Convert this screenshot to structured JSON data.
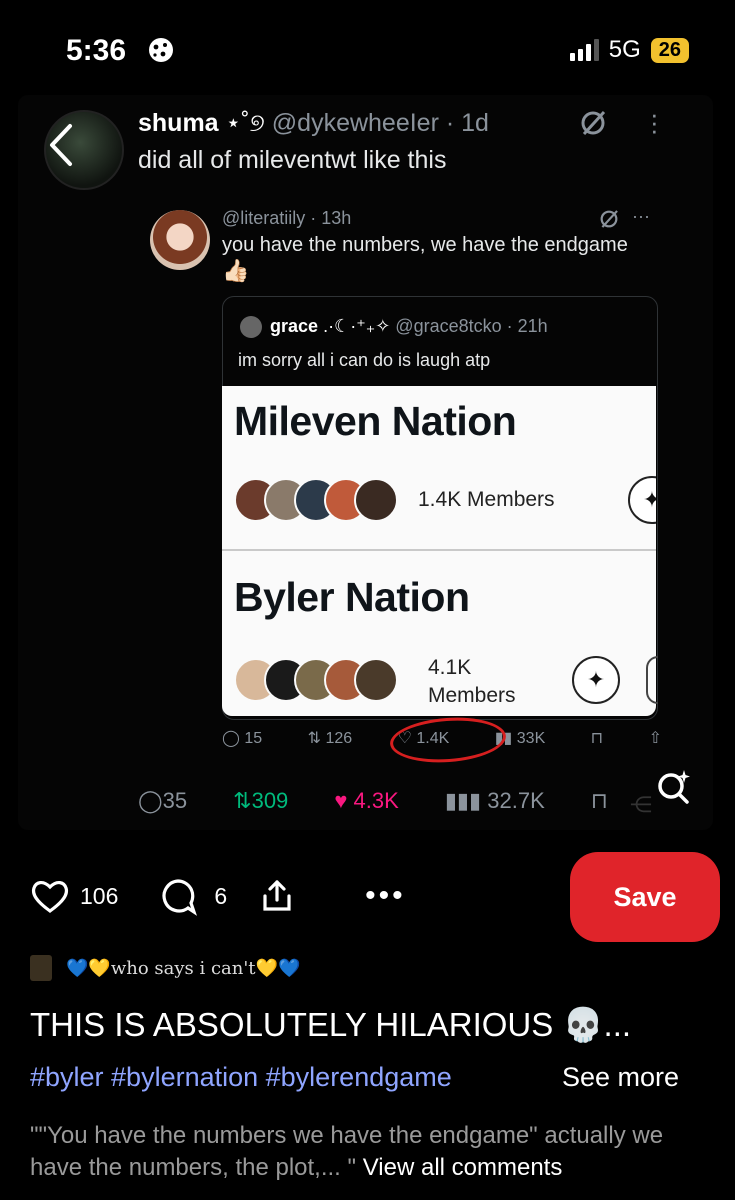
{
  "status_bar": {
    "time": "5:36",
    "network": "5G",
    "battery": "26"
  },
  "tweet": {
    "display_name": "shuma",
    "name_emoji": "⋆˚୭",
    "handle": "@dykewheeIer",
    "age": "· 1d",
    "text": "did all of mileventwt like this",
    "stats": {
      "replies": "35",
      "retweets": "309",
      "likes": "4.3K",
      "views": "32.7K"
    }
  },
  "quoted_tweet": {
    "handle": "@literatiily · 13h",
    "text": "you have the numbers, we have the endgame",
    "emoji": "👍🏻",
    "stats": {
      "replies": "15",
      "retweets": "126",
      "likes": "1.4K",
      "views": "33K"
    }
  },
  "inner_quote": {
    "display_name": "grace",
    "name_decor": ".·☾·⁺₊✧",
    "handle": "@grace8tcko · 21h",
    "text": "im sorry all i can do is laugh atp",
    "communities": [
      {
        "name": "Mileven Nation",
        "members": "1.4K Members"
      },
      {
        "name": "Byler Nation",
        "members_num": "4.1K",
        "members_label": "Members"
      }
    ]
  },
  "pin": {
    "likes": "106",
    "comments": "6",
    "save_label": "Save",
    "author": "💙💛who says i can't💛💙",
    "title": "THIS IS ABSOLUTELY HILARIOUS 💀...",
    "hashtags": "#byler #bylernation #bylerendgame",
    "see_more": "See more",
    "comment_preview": "\"\"You have the numbers we have the endgame\" actually we have the numbers, the plot,... \"",
    "view_all": "View all comments"
  },
  "colors": {
    "save": "#e0242a",
    "like": "#f91880",
    "retweet": "#00ba7c",
    "hashtag": "#8fa5ff",
    "highlight": "#d61f1f"
  }
}
